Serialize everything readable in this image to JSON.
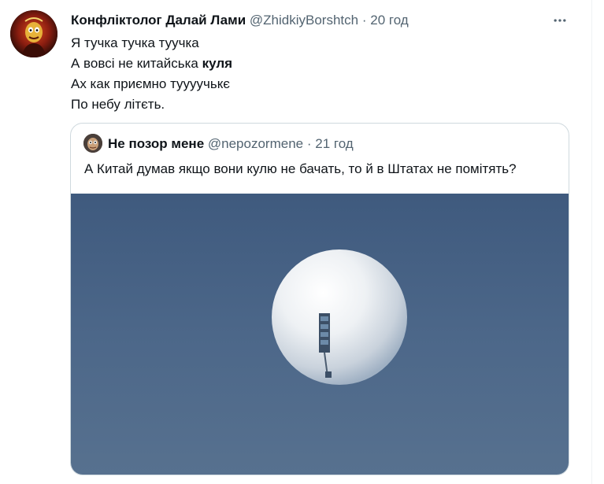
{
  "tweet": {
    "author_name": "Конфліктолог Далай Лами",
    "author_handle": "@ZhidkiyBorshtch",
    "separator": "·",
    "time": "20 год",
    "lines": {
      "line1": "Я тучка тучка туучка",
      "line2_prefix": "А вовсі не китайська ",
      "line2_bold": "куля",
      "line3": "Ах как приємно туууучькє",
      "line4": "По небу літєть."
    }
  },
  "quoted": {
    "author_name": "Не позор мене",
    "author_handle": "@nepozormene",
    "separator": "·",
    "time": "21 год",
    "text": "А Китай думав якщо вони кулю не бачать, то й в Штатах не помітять?"
  },
  "icons": {
    "more": "more-horizontal-icon",
    "avatar": "avatar-image",
    "photo": "balloon-photo"
  },
  "colors": {
    "text": "#0f1419",
    "muted": "#536471",
    "border": "#cfd9de",
    "photo_sky": "#4a6486"
  }
}
